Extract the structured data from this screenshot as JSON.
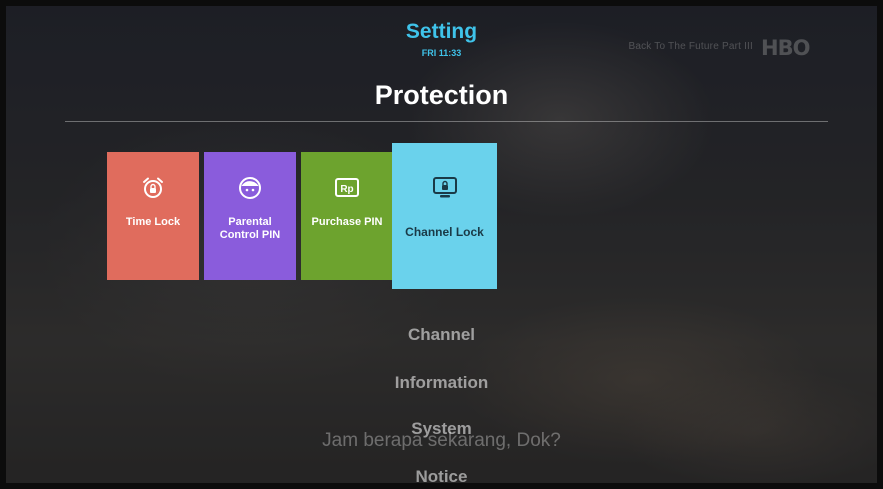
{
  "header": {
    "title": "Setting",
    "time": "FRI 11:33",
    "now_playing": "Back To The Future Part III",
    "channel_logo": "HBO"
  },
  "section": {
    "title": "Protection"
  },
  "tiles": [
    {
      "label": "Time Lock",
      "icon": "alarm-clock-lock-icon",
      "color": "#e06c5d"
    },
    {
      "label": "Parental Control PIN",
      "icon": "child-face-icon",
      "color": "#8a5cdc"
    },
    {
      "label": "Purchase PIN",
      "icon": "rp-currency-icon",
      "color": "#6da32e"
    },
    {
      "label": "Channel Lock",
      "icon": "tv-lock-icon",
      "color": "#6ad2ec",
      "selected": true
    }
  ],
  "menu": [
    {
      "label": "Channel"
    },
    {
      "label": "Information"
    },
    {
      "label": "System"
    },
    {
      "label": "Notice"
    }
  ],
  "subtitle": "Jam berapa sekarang, Dok?",
  "colors": {
    "accent": "#3fc3ea"
  }
}
